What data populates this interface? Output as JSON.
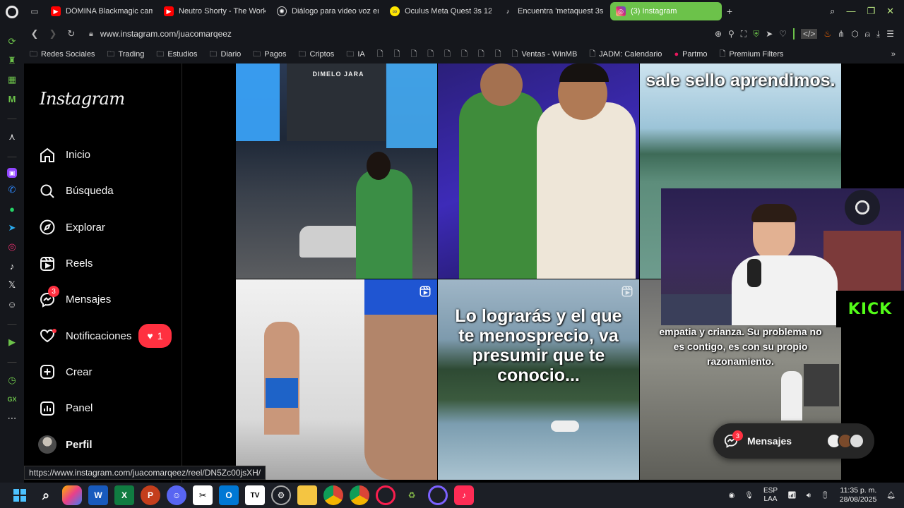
{
  "browser": {
    "tabs": [
      {
        "title": "DÓMINA Blackmagic cam",
        "fav_color": "#ff0000"
      },
      {
        "title": "Neutro Shorty - The Work",
        "fav_color": "#ff0000"
      },
      {
        "title": "Diálogo para video voz en",
        "fav_color": "#444444"
      },
      {
        "title": "Oculus Meta Quest 3s 128",
        "fav_color": "#ffe600"
      },
      {
        "title": "Encuentra 'metaquest 3s",
        "fav_color": "#111111"
      },
      {
        "title": "(3) Instagram",
        "fav_color": "#d62976"
      }
    ],
    "url": "www.instagram.com/juacomarqeez",
    "bookmarks": [
      {
        "label": "Redes Sociales",
        "type": "folder"
      },
      {
        "label": "Trading",
        "type": "folder"
      },
      {
        "label": "Estudios",
        "type": "folder"
      },
      {
        "label": "Diario",
        "type": "folder"
      },
      {
        "label": "Pagos",
        "type": "folder"
      },
      {
        "label": "Criptos",
        "type": "folder"
      },
      {
        "label": "IA",
        "type": "folder"
      },
      {
        "label": "",
        "type": "page"
      },
      {
        "label": "",
        "type": "page"
      },
      {
        "label": "",
        "type": "page"
      },
      {
        "label": "",
        "type": "page"
      },
      {
        "label": "",
        "type": "page"
      },
      {
        "label": "",
        "type": "page"
      },
      {
        "label": "",
        "type": "page"
      },
      {
        "label": "",
        "type": "page"
      },
      {
        "label": "Ventas - WinMB",
        "type": "page"
      },
      {
        "label": "JADM: Calendario",
        "type": "page"
      },
      {
        "label": "Partmo",
        "type": "site"
      },
      {
        "label": "Premium Filters",
        "type": "page"
      }
    ],
    "status_url": "https://www.instagram.com/juacomarqeez/reel/DN5Zc00jsXH/",
    "accent": "#6cc24a"
  },
  "instagram": {
    "logo": "Instagram",
    "nav": [
      {
        "label": "Inicio",
        "icon": "home-icon"
      },
      {
        "label": "Búsqueda",
        "icon": "search-icon"
      },
      {
        "label": "Explorar",
        "icon": "compass-icon"
      },
      {
        "label": "Reels",
        "icon": "reels-icon"
      },
      {
        "label": "Mensajes",
        "icon": "messenger-icon",
        "badge": "3"
      },
      {
        "label": "Notificaciones",
        "icon": "heart-icon",
        "pill": "1"
      },
      {
        "label": "Crear",
        "icon": "plus-square-icon"
      },
      {
        "label": "Panel",
        "icon": "chart-icon"
      },
      {
        "label": "Perfil",
        "icon": "avatar"
      }
    ],
    "posts": [
      {
        "caption": "DIMELO JARA"
      },
      {
        "caption": ""
      },
      {
        "caption": "sale sello aprendimos."
      },
      {
        "caption": ""
      },
      {
        "caption": "Lo lograrás y el que te menosprecio, va presumir que te conocio..."
      },
      {
        "caption": "empatia y crianza. Su problema no es contigo, es con su propio razonamiento."
      }
    ],
    "messages_float": {
      "label": "Mensajes",
      "badge": "3"
    },
    "overlay_brand": "KICK"
  },
  "taskbar": {
    "lang_line1": "ESP",
    "lang_line2": "LAA",
    "time": "11:35 p. m.",
    "date": "28/08/2025"
  }
}
